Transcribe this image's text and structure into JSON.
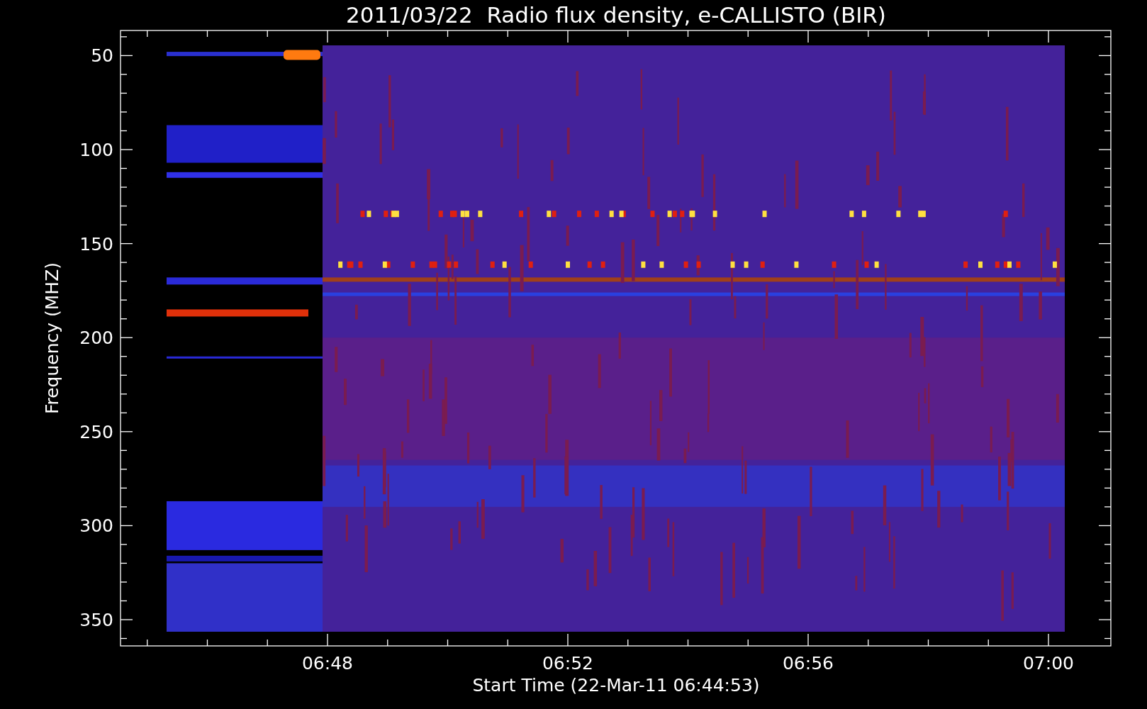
{
  "title": "2011/03/22  Radio flux density, e-CALLISTO (BIR)",
  "y_axis": {
    "label": "Frequency (MHZ)",
    "ticks": [
      "50",
      "100",
      "150",
      "200",
      "250",
      "300",
      "350"
    ]
  },
  "x_axis": {
    "label": "Start Time (22-Mar-11 06:44:53)",
    "ticks": [
      "06:48",
      "06:52",
      "06:56",
      "07:00"
    ]
  }
}
